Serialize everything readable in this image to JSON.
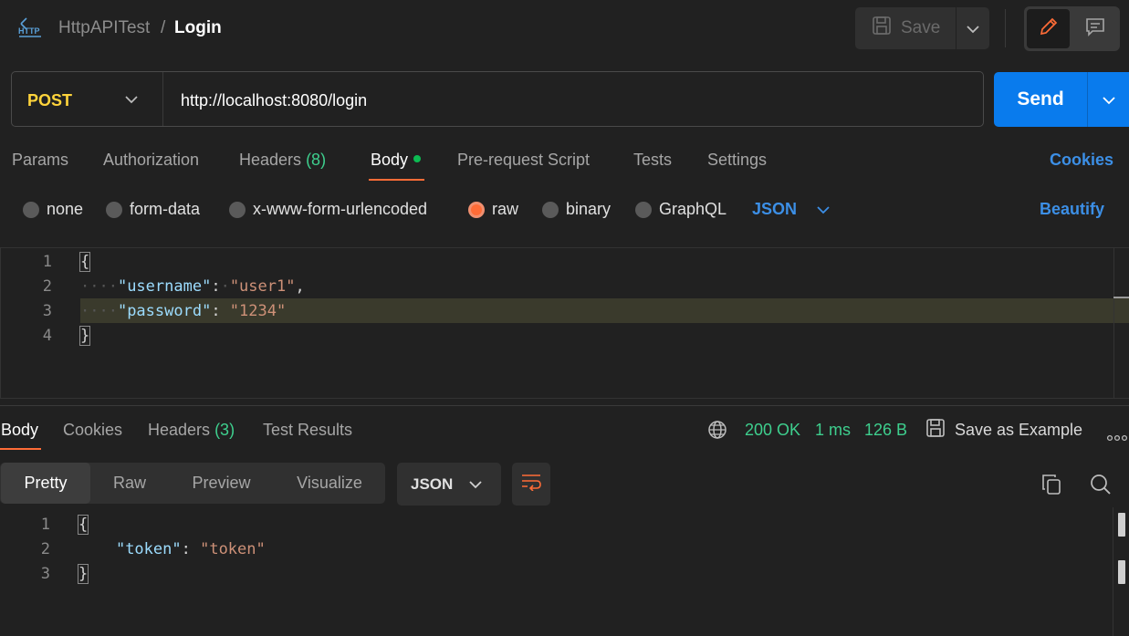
{
  "header": {
    "collection": "HttpAPITest",
    "separator": "/",
    "request_name": "Login",
    "save_label": "Save"
  },
  "request": {
    "method": "POST",
    "url": "http://localhost:8080/login",
    "send_label": "Send"
  },
  "request_tabs": {
    "params": "Params",
    "authorization": "Authorization",
    "headers": "Headers",
    "headers_count": "(8)",
    "body": "Body",
    "pre_request": "Pre-request Script",
    "tests": "Tests",
    "settings": "Settings",
    "cookies": "Cookies"
  },
  "body_types": {
    "none": "none",
    "form_data": "form-data",
    "urlencoded": "x-www-form-urlencoded",
    "raw": "raw",
    "binary": "binary",
    "graphql": "GraphQL",
    "selected": "raw",
    "language": "JSON",
    "beautify": "Beautify"
  },
  "request_body": {
    "line_numbers": [
      "1",
      "2",
      "3",
      "4"
    ],
    "open_brace": "{",
    "close_brace": "}",
    "key1": "\"username\"",
    "val1": "\"user1\"",
    "key2": "\"password\"",
    "val2": "\"1234\""
  },
  "response_tabs": {
    "body": "Body",
    "cookies": "Cookies",
    "headers": "Headers",
    "headers_count": "(3)",
    "test_results": "Test Results"
  },
  "response_status": {
    "status": "200 OK",
    "time": "1 ms",
    "size": "126 B",
    "save_example": "Save as Example",
    "more": "ooo"
  },
  "response_view": {
    "pretty": "Pretty",
    "raw": "Raw",
    "preview": "Preview",
    "visualize": "Visualize",
    "format": "JSON"
  },
  "response_body": {
    "line_numbers": [
      "1",
      "2",
      "3"
    ],
    "open_brace": "{",
    "close_brace": "}",
    "key1": "\"token\"",
    "val1": "\"token\""
  },
  "colors": {
    "accent_orange": "#ff6c37",
    "send_blue": "#097bed",
    "link_blue": "#3c8fe6",
    "success_green": "#3ecf8e",
    "method_yellow": "#ffd43b"
  }
}
